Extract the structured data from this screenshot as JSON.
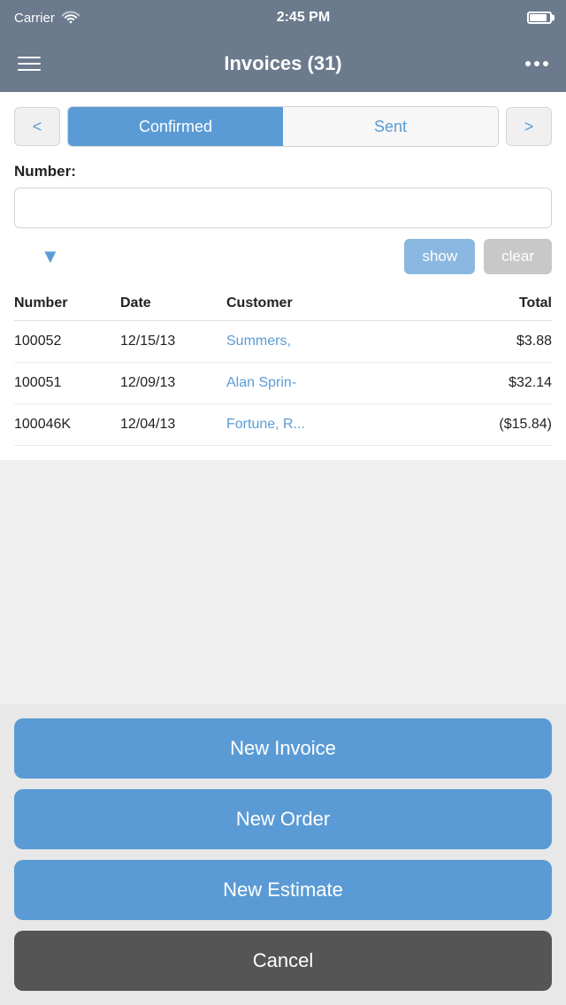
{
  "statusBar": {
    "carrier": "Carrier",
    "wifi": "wifi",
    "time": "2:45 PM",
    "battery": "battery"
  },
  "header": {
    "title": "Invoices (31)",
    "menu": "hamburger",
    "more": "more"
  },
  "tabs": {
    "confirmed": "Confirmed",
    "sent": "Sent",
    "prevLabel": "<",
    "nextLabel": ">"
  },
  "filter": {
    "numberLabel": "Number:",
    "numberPlaceholder": "",
    "showLabel": "show",
    "clearLabel": "clear"
  },
  "tableHeaders": {
    "number": "Number",
    "date": "Date",
    "customer": "Customer",
    "total": "Total"
  },
  "rows": [
    {
      "number": "100052",
      "date": "12/15/13",
      "customer": "Summers,",
      "total": "$3.88"
    },
    {
      "number": "100051",
      "date": "12/09/13",
      "customer": "Alan Sprin-",
      "total": "$32.14"
    },
    {
      "number": "100046K",
      "date": "12/04/13",
      "customer": "Fortune, R...",
      "total": "($15.84)"
    }
  ],
  "overlay": {
    "newInvoice": "New Invoice",
    "newOrder": "New Order",
    "newEstimate": "New Estimate",
    "cancel": "Cancel"
  }
}
